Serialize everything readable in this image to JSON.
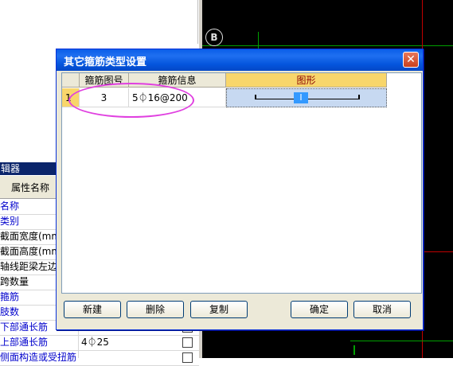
{
  "background": {
    "axis_label": "B",
    "property_panel": {
      "title": "辑器",
      "header": "属性名称",
      "rows": [
        {
          "name": "名称",
          "value": "",
          "color": "#0000cc",
          "checkbox": false
        },
        {
          "name": "类别",
          "value": "",
          "color": "#0000cc",
          "checkbox": false
        },
        {
          "name": "截面宽度(mm)",
          "value": "",
          "color": "#000000",
          "checkbox": false
        },
        {
          "name": "截面高度(mm)",
          "value": "",
          "color": "#000000",
          "checkbox": false
        },
        {
          "name": "轴线距梁左边",
          "value": "",
          "color": "#000000",
          "checkbox": false
        },
        {
          "name": "跨数量",
          "value": "",
          "color": "#000000",
          "checkbox": false
        },
        {
          "name": "箍筋",
          "value": "",
          "color": "#0000cc",
          "checkbox": false
        },
        {
          "name": "肢数",
          "value": "",
          "color": "#0000cc",
          "checkbox": false
        },
        {
          "name": "下部通长筋",
          "value": "",
          "color": "#0000cc",
          "checkbox": true
        },
        {
          "name": "上部通长筋",
          "value": "4⏀25",
          "color": "#0000cc",
          "checkbox": true
        },
        {
          "name": "侧面构造或受扭筋",
          "value": "",
          "color": "#0000cc",
          "checkbox": true
        }
      ]
    }
  },
  "dialog": {
    "title": "其它箍筋类型设置",
    "close_label": "✕",
    "columns": [
      "箍筋图号",
      "箍筋信息",
      "图形"
    ],
    "rows": [
      {
        "index": "1",
        "figure_no": "3",
        "info": "5⏀16@200",
        "shape_cursor": "I"
      }
    ],
    "buttons": {
      "new": "新建",
      "delete": "删除",
      "copy": "复制",
      "ok": "确定",
      "cancel": "取消"
    }
  },
  "colors": {
    "titlebar": "#0a5ee8",
    "highlight": "#e040e0",
    "selected_header": "#f8d66b"
  }
}
